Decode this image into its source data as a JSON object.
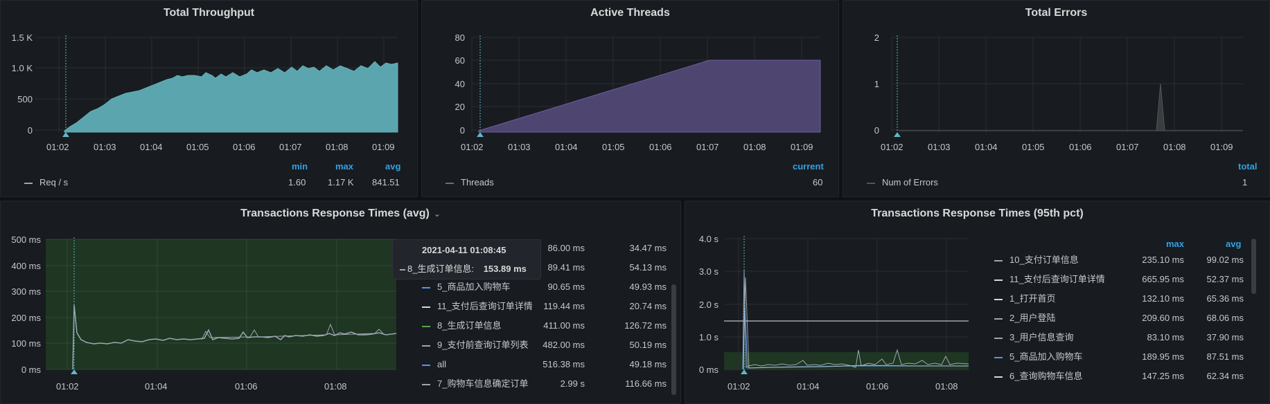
{
  "panels": {
    "throughput": {
      "title": "Total Throughput",
      "y_ticks": [
        "1.5 K",
        "1.0 K",
        "500",
        "0"
      ],
      "x_ticks": [
        "01:02",
        "01:03",
        "01:04",
        "01:05",
        "01:06",
        "01:07",
        "01:08",
        "01:09"
      ],
      "legend_headers": [
        "min",
        "max",
        "avg"
      ],
      "series": {
        "name": "Req / s",
        "min": "1.60",
        "max": "1.17 K",
        "avg": "841.51",
        "color": "#5ba5ae"
      }
    },
    "threads": {
      "title": "Active Threads",
      "y_ticks": [
        "80",
        "60",
        "40",
        "20",
        "0"
      ],
      "x_ticks": [
        "01:02",
        "01:03",
        "01:04",
        "01:05",
        "01:06",
        "01:07",
        "01:08",
        "01:09"
      ],
      "legend_headers": [
        "current"
      ],
      "series": {
        "name": "Threads",
        "current": "60",
        "color": "#4e4571"
      }
    },
    "errors": {
      "title": "Total Errors",
      "y_ticks": [
        "2",
        "1",
        "0"
      ],
      "x_ticks": [
        "01:02",
        "01:03",
        "01:04",
        "01:05",
        "01:06",
        "01:07",
        "01:08",
        "01:09"
      ],
      "legend_headers": [
        "total"
      ],
      "series": {
        "name": "Num of Errors",
        "total": "1",
        "color": "#555"
      }
    },
    "rt_avg": {
      "title": "Transactions Response Times (avg)",
      "y_ticks": [
        "500 ms",
        "400 ms",
        "300 ms",
        "200 ms",
        "100 ms",
        "0 ms"
      ],
      "x_ticks": [
        "01:02",
        "01:04",
        "01:06",
        "01:08"
      ],
      "tooltip": {
        "time": "2021-04-11 01:08:45",
        "label": "8_生成订单信息:",
        "value": "153.89 ms"
      },
      "partial_rows": [
        {
          "max": "86.00 ms",
          "avg": "34.47 ms"
        },
        {
          "max": "89.41 ms",
          "avg": "54.13 ms"
        }
      ],
      "rows": [
        {
          "name": "5_商品加入购物车",
          "max": "90.65 ms",
          "avg": "49.93 ms",
          "color": "#5794f2"
        },
        {
          "name": "11_支付后查询订单详情",
          "max": "119.44 ms",
          "avg": "20.74 ms",
          "color": "#d8d9da"
        },
        {
          "name": "8_生成订单信息",
          "max": "411.00 ms",
          "avg": "126.72 ms",
          "color": "#56a64b"
        },
        {
          "name": "9_支付前查询订单列表",
          "max": "482.00 ms",
          "avg": "50.19 ms",
          "color": "#9fa7b3"
        },
        {
          "name": "all",
          "max": "516.38 ms",
          "avg": "49.18 ms",
          "color": "#5794f2"
        },
        {
          "name": "7_购物车信息确定订单",
          "max": "2.99 s",
          "avg": "116.66 ms",
          "color": "#9fa7b3"
        }
      ]
    },
    "rt_95": {
      "title": "Transactions Response Times (95th pct)",
      "y_ticks": [
        "4.0 s",
        "3.0 s",
        "2.0 s",
        "1.0 s",
        "0 ms"
      ],
      "x_ticks": [
        "01:02",
        "01:04",
        "01:06",
        "01:08"
      ],
      "headers": [
        "max",
        "avg"
      ],
      "rows": [
        {
          "name": "10_支付订单信息",
          "max": "235.10 ms",
          "avg": "99.02 ms",
          "color": "#9fa7b3"
        },
        {
          "name": "11_支付后查询订单详情",
          "max": "665.95 ms",
          "avg": "52.37 ms",
          "color": "#d8d9da"
        },
        {
          "name": "1_打开首页",
          "max": "132.10 ms",
          "avg": "65.36 ms",
          "color": "#d8d9da"
        },
        {
          "name": "2_用户登陆",
          "max": "209.60 ms",
          "avg": "68.06 ms",
          "color": "#9fa7b3"
        },
        {
          "name": "3_用户信息查询",
          "max": "83.10 ms",
          "avg": "37.90 ms",
          "color": "#9fa7b3"
        },
        {
          "name": "5_商品加入购物车",
          "max": "189.95 ms",
          "avg": "87.51 ms",
          "color": "#5794f2"
        },
        {
          "name": "6_查询购物车信息",
          "max": "147.25 ms",
          "avg": "62.34 ms",
          "color": "#d8d9da"
        }
      ]
    }
  }
}
